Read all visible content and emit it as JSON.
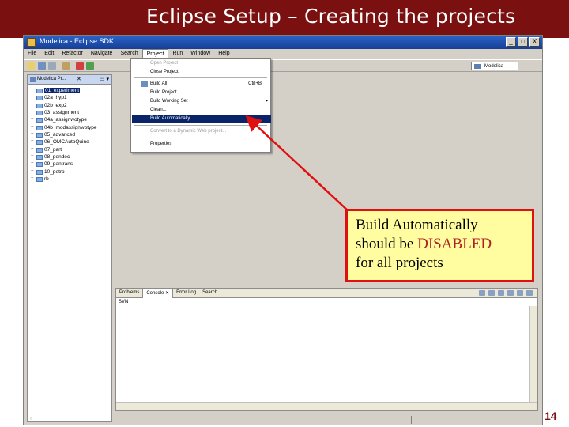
{
  "slide": {
    "title": "Eclipse Setup – Creating the projects",
    "page_number": "14",
    "header_color": "#7a1010"
  },
  "window": {
    "title": "Modelica - Eclipse SDK",
    "controls": [
      "_",
      "□",
      "X"
    ]
  },
  "menubar": [
    "File",
    "Edit",
    "Refactor",
    "Navigate",
    "Search",
    "Project",
    "Run",
    "Window",
    "Help"
  ],
  "menubar_active": "Project",
  "toolbar": {
    "perspective_label": "Modelica"
  },
  "explorer": {
    "tab_label": "Modelica Pr...",
    "close_glyph": "✕",
    "buttons": "▭ ▾",
    "items": [
      {
        "label": "01_experiment",
        "selected": true
      },
      {
        "label": "02a_hyp1"
      },
      {
        "label": "02b_exp2"
      },
      {
        "label": "03_assignment"
      },
      {
        "label": "04a_assignwotype"
      },
      {
        "label": "04b_modassignwotype"
      },
      {
        "label": "05_advanced"
      },
      {
        "label": "06_OMCAutoQuine"
      },
      {
        "label": "07_part"
      },
      {
        "label": "08_pendec"
      },
      {
        "label": "09_pantrans"
      },
      {
        "label": "10_petro"
      },
      {
        "label": "rb"
      }
    ]
  },
  "project_menu": {
    "items": [
      {
        "label": "Open Project",
        "disabled": true
      },
      {
        "label": "Close Project"
      },
      {
        "label": "Build All",
        "shortcut": "Ctrl+B"
      },
      {
        "label": "Build Project"
      },
      {
        "label": "Build Working Set",
        "submenu_glyph": "▸"
      },
      {
        "label": "Clean..."
      },
      {
        "label": "Build Automatically",
        "highlighted": true
      },
      {
        "label": "Convert to a Dynamic Web project...",
        "disabled": true
      },
      {
        "label": "Properties"
      }
    ]
  },
  "console": {
    "tabs": [
      "Problems",
      "Console ✕",
      "Error Log",
      "Search"
    ],
    "active_tab": "Console ✕",
    "label": "SVN"
  },
  "callout": {
    "line1": "Build Automatically",
    "line2_prefix": "should be ",
    "line2_em": "DISABLED",
    "line3": "for all projects",
    "border_color": "#e01010",
    "fill_color": "#fffda0"
  }
}
